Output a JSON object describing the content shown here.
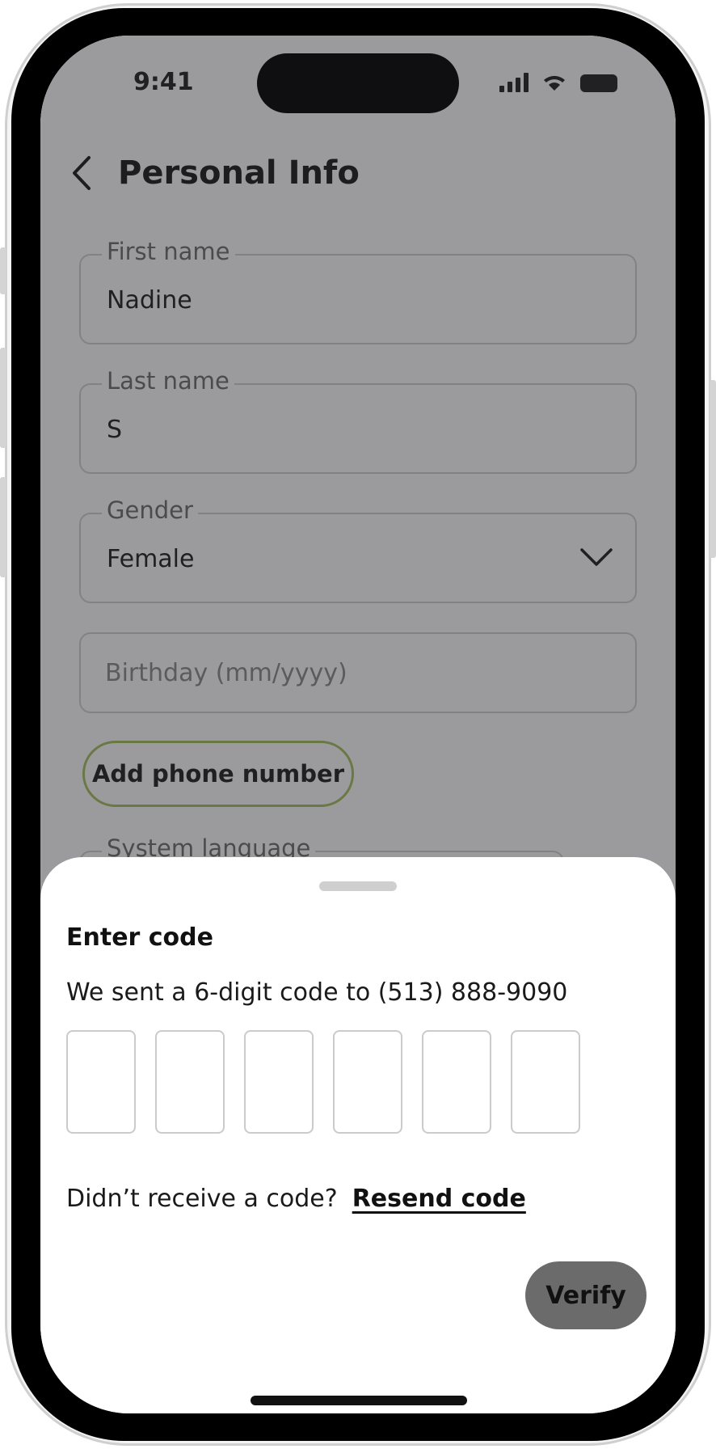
{
  "status_bar": {
    "time": "9:41"
  },
  "header": {
    "title": "Personal Info",
    "back_icon": "chevron-left-icon"
  },
  "form": {
    "first_name": {
      "label": "First name",
      "value": "Nadine"
    },
    "last_name": {
      "label": "Last name",
      "value": "S"
    },
    "gender": {
      "label": "Gender",
      "value": "Female",
      "icon": "chevron-down-icon"
    },
    "birthday": {
      "placeholder": "Birthday (mm/yyyy)",
      "value": ""
    },
    "add_phone_label": "Add phone number",
    "system_language": {
      "label": "System language"
    }
  },
  "sheet": {
    "title": "Enter code",
    "subtitle": "We sent a 6-digit code to (513) 888-9090",
    "code_digits": [
      "",
      "",
      "",
      "",
      "",
      ""
    ],
    "resend_prompt": "Didn’t receive a code?",
    "resend_link": "Resend code",
    "verify_label": "Verify"
  },
  "colors": {
    "add_phone_border": "#a6c05c",
    "verify_bg": "#6b6b6b",
    "scrim": "rgba(34,34,40,0.45)"
  }
}
